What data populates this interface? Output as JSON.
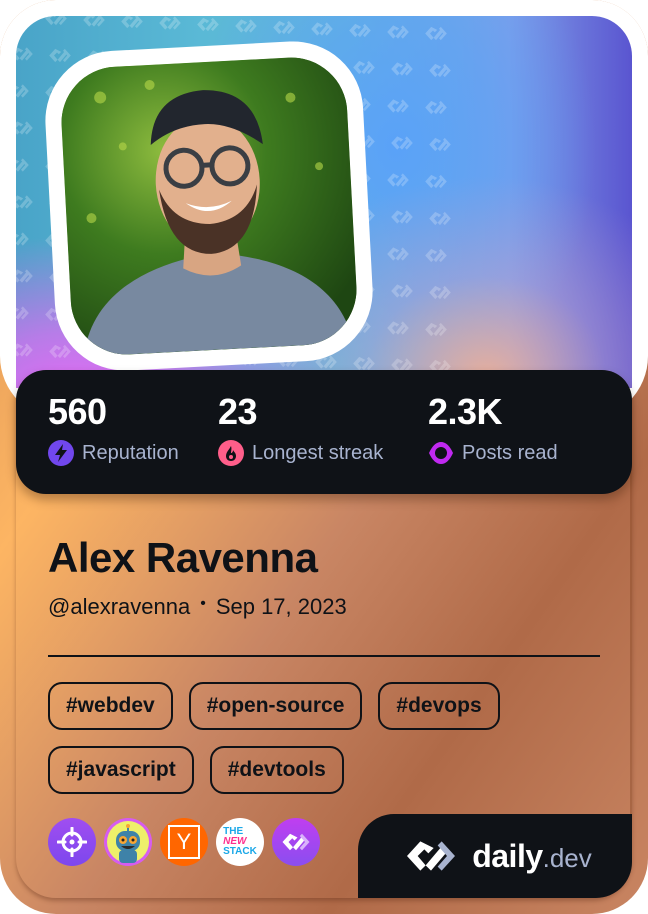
{
  "profile": {
    "name": "Alex Ravenna",
    "username": "@alexravenna",
    "separator": "•",
    "joined": "Sep 17, 2023",
    "avatar_alt": "Profile photo of Alex Ravenna"
  },
  "stats": [
    {
      "value": "560",
      "label": "Reputation",
      "icon": "lightning-icon",
      "icon_color": "#7147ed"
    },
    {
      "value": "23",
      "label": "Longest streak",
      "icon": "flame-icon",
      "icon_color": "#ff5e8a"
    },
    {
      "value": "2.3K",
      "label": "Posts read",
      "icon": "eye-icon",
      "icon_color": "#c029f0"
    }
  ],
  "tags": [
    "#webdev",
    "#open-source",
    "#devops",
    "#javascript",
    "#devtools"
  ],
  "sources": [
    {
      "name": "Crosshair source",
      "icon": "crosshair-icon",
      "color": "#9d4ef0"
    },
    {
      "name": "Robot source",
      "icon": "robot-icon",
      "color": "#e9f56a"
    },
    {
      "name": "Hacker News",
      "icon": "y-combinator-icon",
      "text": "Y",
      "color": "#ff6600"
    },
    {
      "name": "The New Stack",
      "icon": "the-new-stack-icon",
      "lines": [
        "THE",
        "NEW",
        "STACK"
      ],
      "color": "#ffffff"
    },
    {
      "name": "daily.dev",
      "icon": "daily-dev-icon",
      "color": "#a13ef0"
    }
  ],
  "brand": {
    "word": "daily",
    "tld": ".dev"
  },
  "colors": {
    "panel": "#0f1217",
    "label": "#a8b3cf",
    "text": "#0f1217"
  }
}
